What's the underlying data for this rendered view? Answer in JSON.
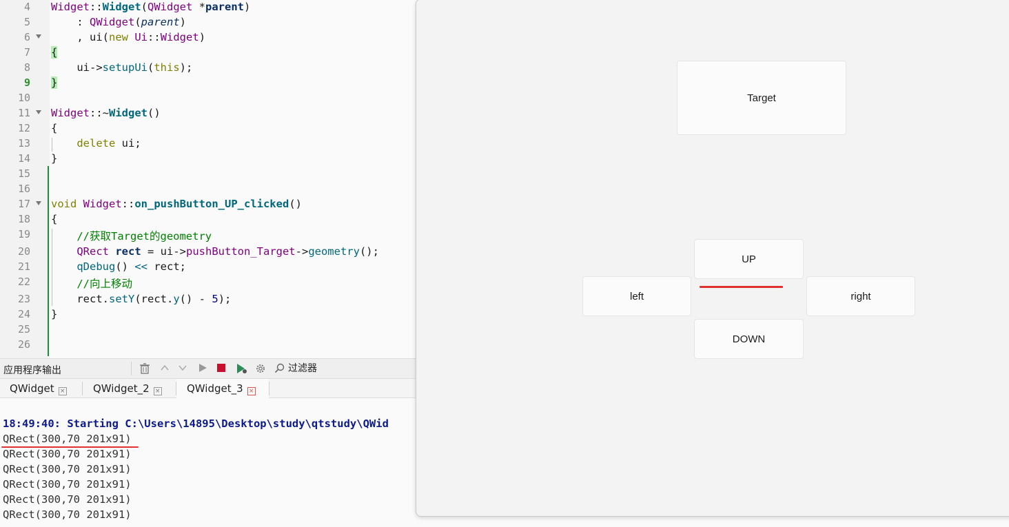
{
  "editor": {
    "line_numbers": [
      "4",
      "5",
      "6",
      "7",
      "8",
      "9",
      "10",
      "11",
      "12",
      "13",
      "14",
      "15",
      "16",
      "17",
      "18",
      "19",
      "20",
      "21",
      "22",
      "23",
      "24",
      "25",
      "26"
    ],
    "current_line": "9",
    "lines": {
      "l4": {
        "a": "Widget",
        "b": "::",
        "c": "Widget",
        "d": "(",
        "e": "QWidget",
        "f": " *",
        "g": "parent",
        "h": ")"
      },
      "l5": {
        "a": "    : ",
        "b": "QWidget",
        "c": "(",
        "d": "parent",
        "e": ")"
      },
      "l6": {
        "a": "    , ui(",
        "b": "new",
        "c": " ",
        "d": "Ui",
        "e": "::",
        "f": "Widget",
        "g": ")"
      },
      "l7": "{",
      "l8": {
        "a": "    ui->",
        "b": "setupUi",
        "c": "(",
        "d": "this",
        "e": ");"
      },
      "l9": "}",
      "l11": {
        "a": "Widget",
        "b": "::~",
        "c": "Widget",
        "d": "()"
      },
      "l12": "{",
      "l13": {
        "a": "    ",
        "b": "delete",
        "c": " ui;"
      },
      "l14": "}",
      "l17": {
        "a": "void",
        "b": " ",
        "c": "Widget",
        "d": "::",
        "e": "on_pushButton_UP_clicked",
        "f": "()"
      },
      "l18": "{",
      "l19": "    //获取Target的geometry",
      "l20": {
        "a": "    ",
        "b": "QRect",
        "c": " ",
        "d": "rect",
        "e": " = ui->",
        "f": "pushButton_Target",
        "g": "->",
        "h": "geometry",
        "i": "();"
      },
      "l21": {
        "a": "    ",
        "b": "qDebug",
        "c": "() ",
        "d": "<<",
        "e": " rect;"
      },
      "l22": "    //向上移动",
      "l23": {
        "a": "    rect.",
        "b": "setY",
        "c": "(rect.",
        "d": "y",
        "e": "() - ",
        "f": "5",
        "g": ");"
      },
      "l24": "}"
    }
  },
  "output": {
    "title": "应用程序输出",
    "filter_label": "过滤器",
    "tabs": [
      {
        "label": "QWidget"
      },
      {
        "label": "QWidget_2"
      },
      {
        "label": "QWidget_3"
      }
    ],
    "lines": [
      "18:49:40: Starting C:\\Users\\14895\\Desktop\\study\\qtstudy\\QWid",
      "QRect(300,70 201x91)",
      "QRect(300,70 201x91)",
      "QRect(300,70 201x91)",
      "QRect(300,70 201x91)",
      "QRect(300,70 201x91)",
      "QRect(300,70 201x91)"
    ]
  },
  "app_window": {
    "target_label": "Target",
    "up_label": "UP",
    "left_label": "left",
    "right_label": "right",
    "down_label": "DOWN"
  },
  "colors": {
    "annotation_red": "#e03131",
    "current_line_green": "#2c8f2c",
    "stop_red": "#c8102e"
  }
}
